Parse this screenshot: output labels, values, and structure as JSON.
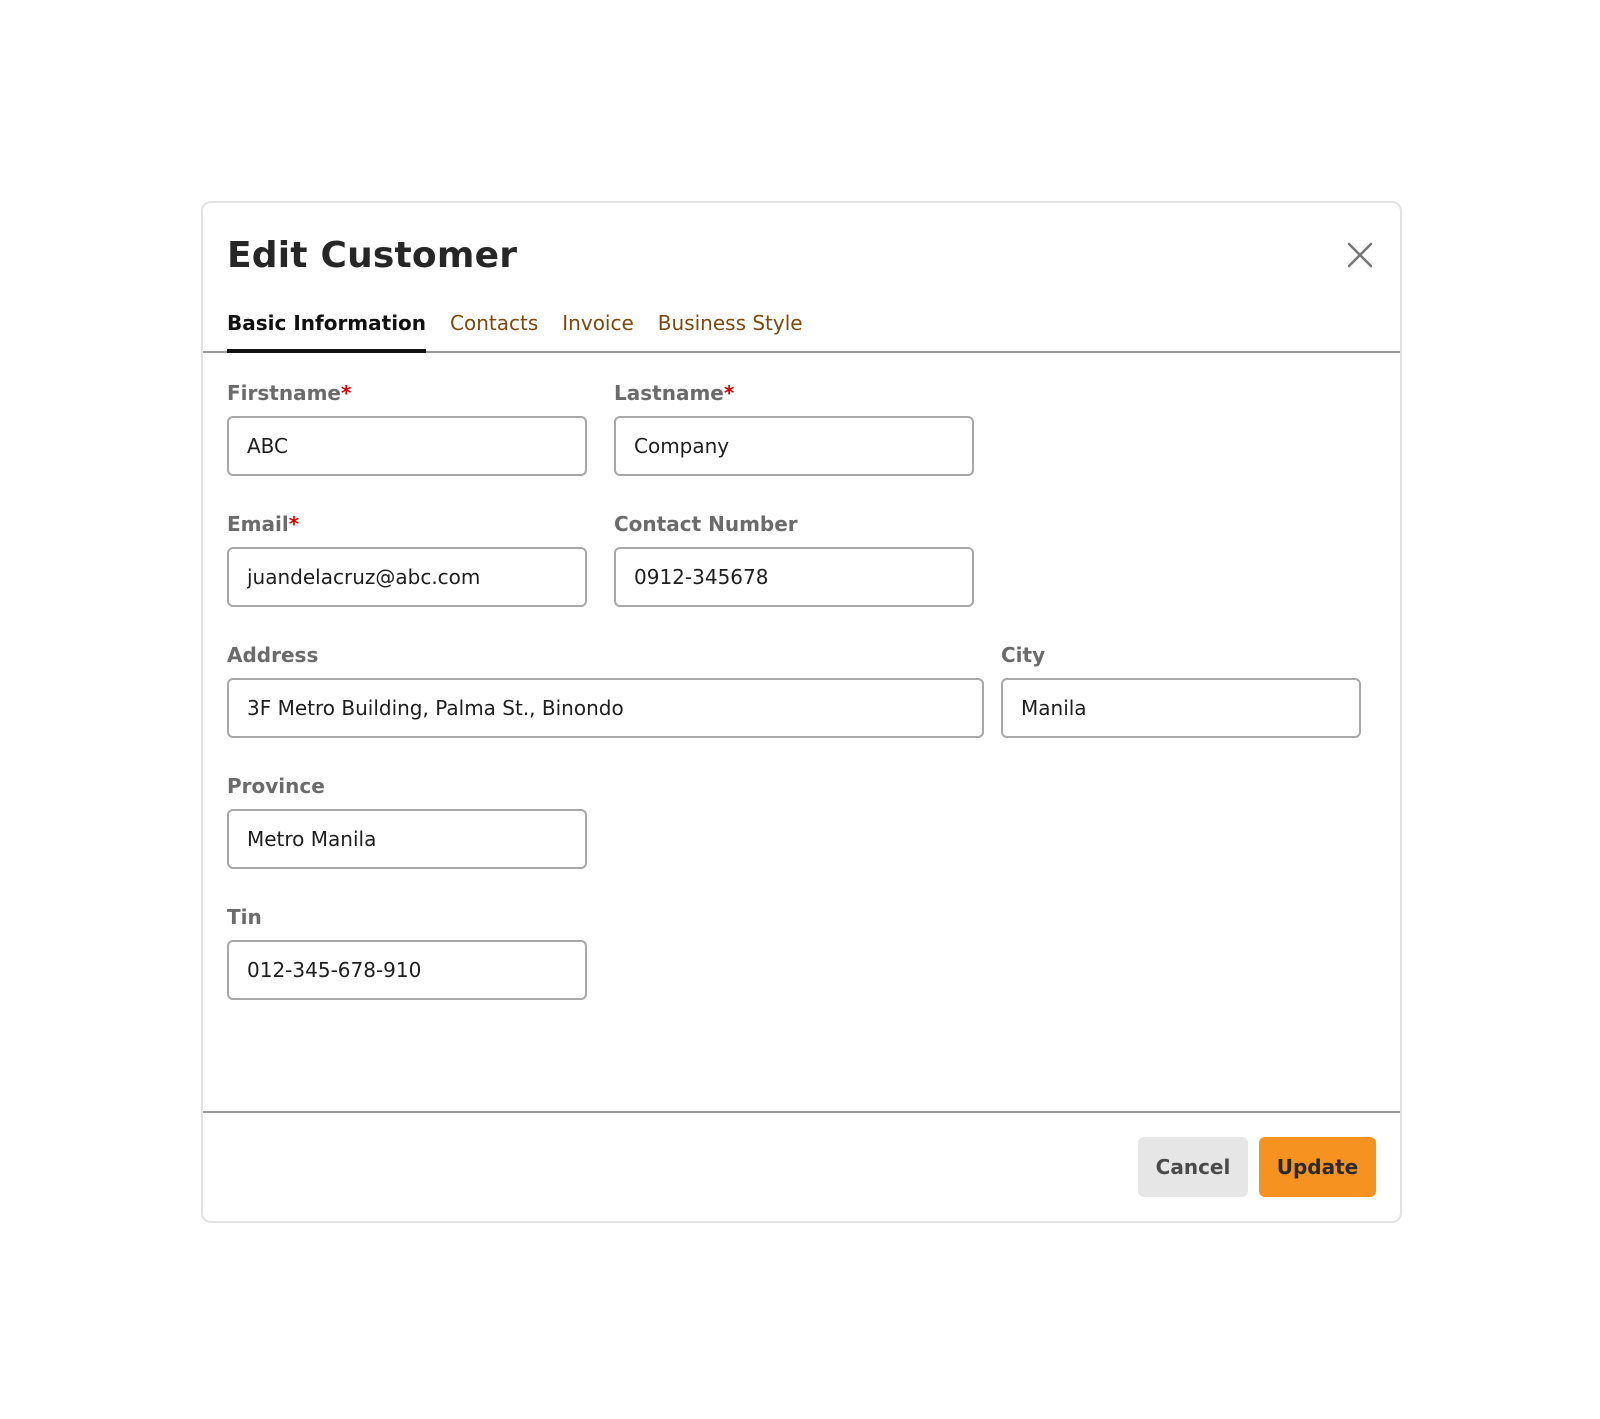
{
  "modal": {
    "title": "Edit Customer",
    "close_icon": "close-icon"
  },
  "tabs": [
    {
      "label": "Basic Information",
      "active": true
    },
    {
      "label": "Contacts",
      "active": false
    },
    {
      "label": "Invoice",
      "active": false
    },
    {
      "label": "Business Style",
      "active": false
    }
  ],
  "form": {
    "firstname": {
      "label": "Firstname",
      "required": "*",
      "value": "ABC"
    },
    "lastname": {
      "label": "Lastname",
      "required": "*",
      "value": "Company"
    },
    "email": {
      "label": "Email",
      "required": "*",
      "value": "juandelacruz@abc.com"
    },
    "contact_number": {
      "label": "Contact Number",
      "value": "0912-345678"
    },
    "address": {
      "label": "Address",
      "value": "3F Metro Building, Palma St., Binondo"
    },
    "city": {
      "label": "City",
      "value": "Manila"
    },
    "province": {
      "label": "Province",
      "value": "Metro Manila"
    },
    "tin": {
      "label": "Tin",
      "value": "012-345-678-910"
    }
  },
  "footer": {
    "cancel_label": "Cancel",
    "update_label": "Update"
  },
  "colors": {
    "accent": "#f59220",
    "tab_inactive": "#7a4a0e",
    "required": "#d10000"
  }
}
